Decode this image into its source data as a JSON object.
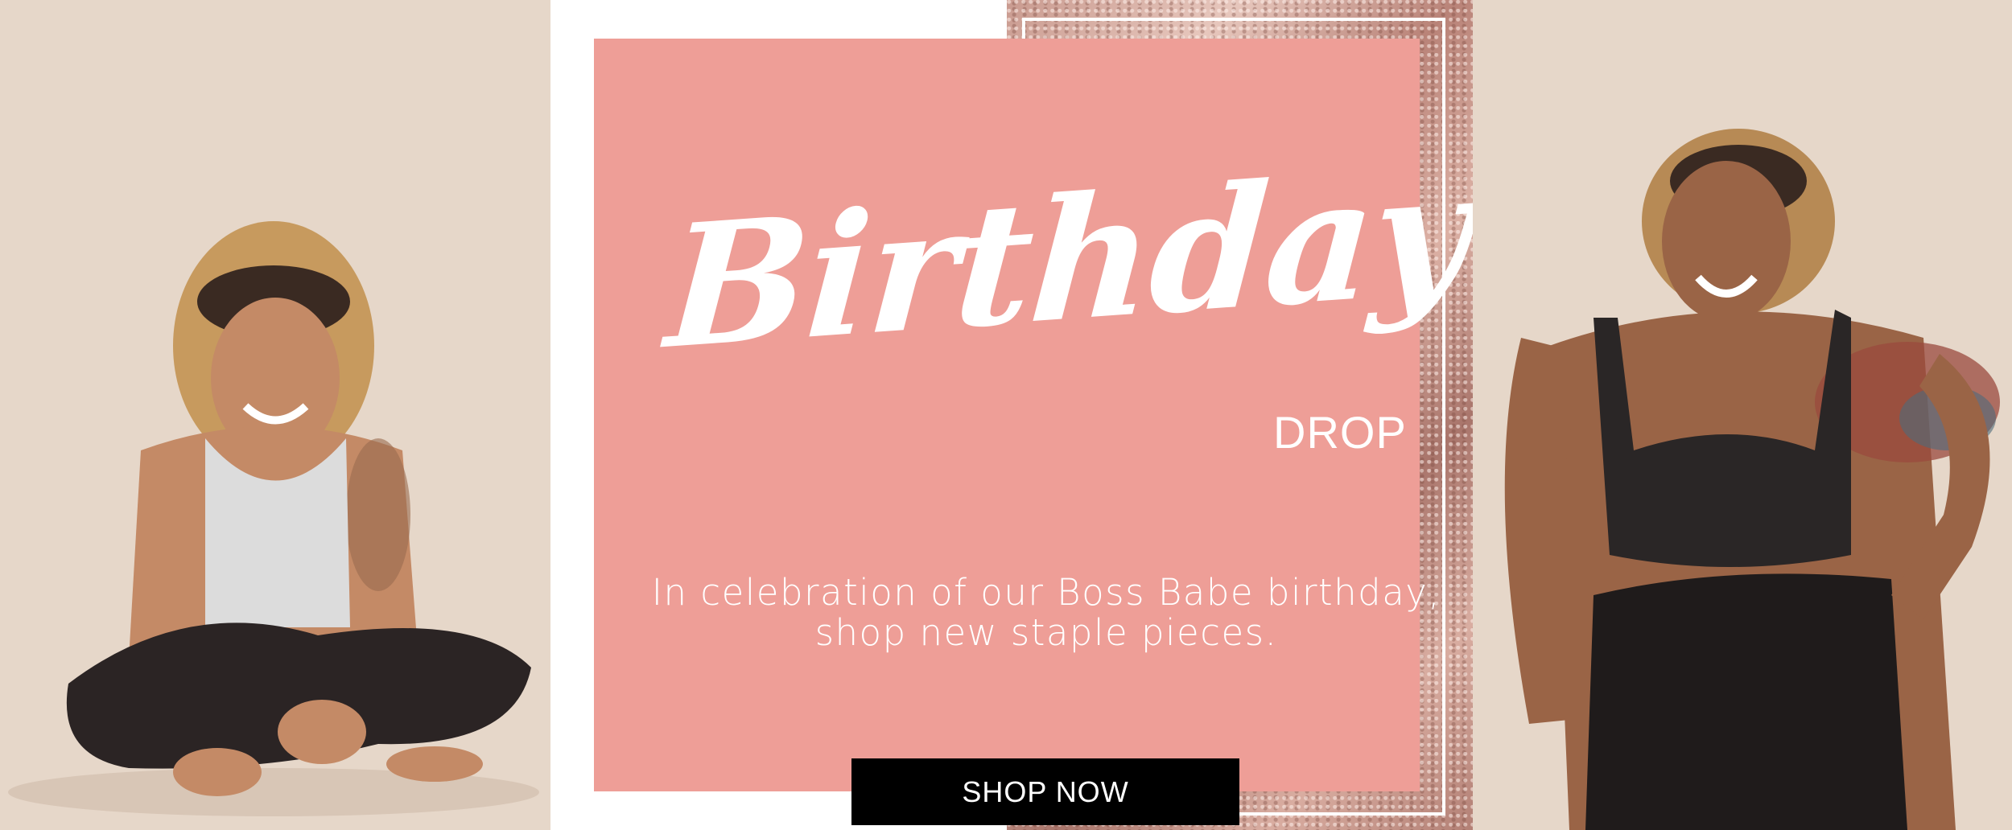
{
  "banner": {
    "headline": "Birthday",
    "subheadline": "DROP",
    "tagline_lines": [
      "In celebration of our Boss Babe birthday,",
      "shop new staple pieces."
    ],
    "cta_label": "SHOP NOW"
  },
  "colors": {
    "background": "#e5d6c8",
    "pink_panel": "#ee9e97",
    "rose_gold_foil": "#c4928a",
    "cta_background": "#000000",
    "text_on_pink": "#ffffff"
  },
  "images": [
    {
      "name": "model-seated-photo",
      "description_icon": "person-photo"
    },
    {
      "name": "model-standing-photo",
      "description_icon": "person-photo"
    }
  ]
}
